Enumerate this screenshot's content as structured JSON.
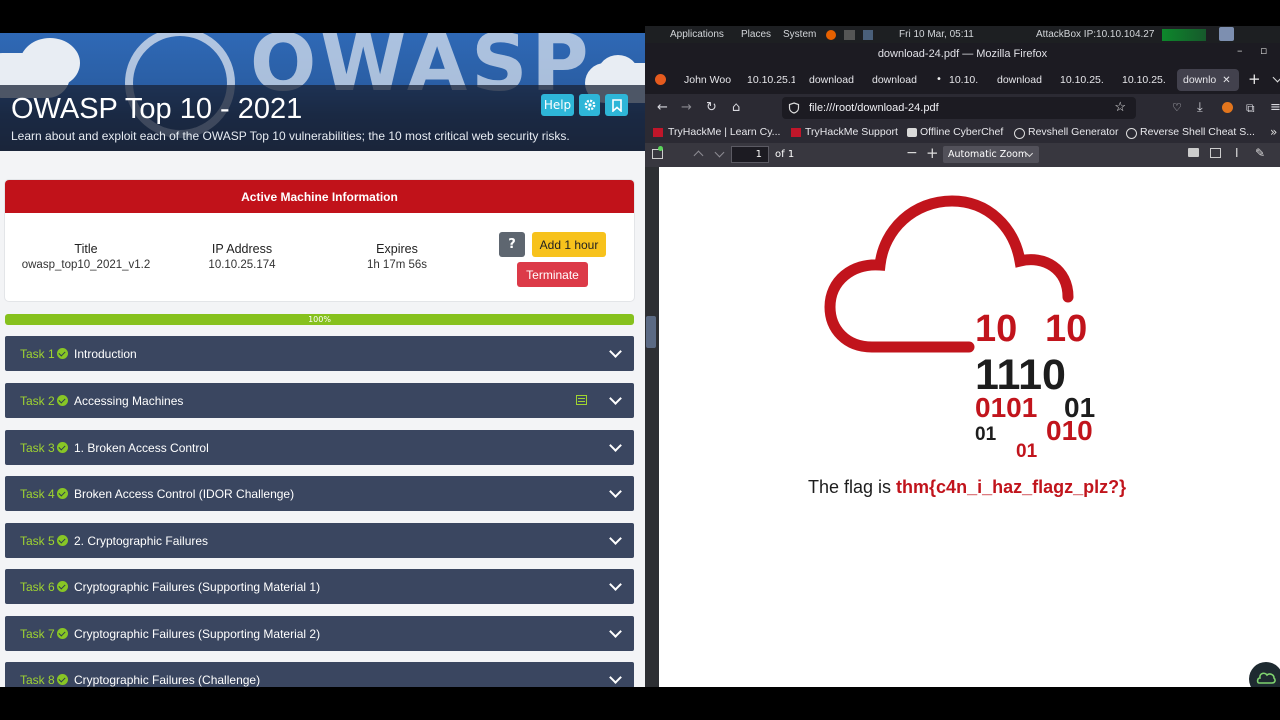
{
  "room": {
    "title": "OWASP Top 10 - 2021",
    "subtitle": "Learn about and exploit each of the OWASP Top 10 vulnerabilities; the 10 most critical web security risks.",
    "logo_text": "OWASP",
    "help_label": "Help",
    "gear_icon": "gear-icon",
    "bookmark_icon": "bookmark-icon"
  },
  "machine": {
    "header": "Active Machine Information",
    "title_label": "Title",
    "title_value": "owasp_top10_2021_v1.2",
    "ip_label": "IP Address",
    "ip_value": "10.10.25.174",
    "expires_label": "Expires",
    "expires_value": "1h 17m 56s",
    "help_q": "?",
    "add_hour": "Add 1 hour",
    "terminate": "Terminate",
    "colors": {
      "header": "#c1121a",
      "add": "#f7c21c",
      "terminate": "#dc3a48"
    }
  },
  "progress": {
    "label": "100%",
    "value": 1.0,
    "color": "#86c11d"
  },
  "tasks": [
    {
      "num": "Task 1",
      "name": "Introduction"
    },
    {
      "num": "Task 2",
      "name": "Accessing Machines"
    },
    {
      "num": "Task 3",
      "name": "1. Broken Access Control"
    },
    {
      "num": "Task 4",
      "name": "Broken Access Control (IDOR Challenge)"
    },
    {
      "num": "Task 5",
      "name": "2. Cryptographic Failures"
    },
    {
      "num": "Task 6",
      "name": "Cryptographic Failures (Supporting Material 1)"
    },
    {
      "num": "Task 7",
      "name": "Cryptographic Failures (Supporting Material 2)"
    },
    {
      "num": "Task 8",
      "name": "Cryptographic Failures (Challenge)"
    }
  ],
  "system": {
    "applications": "Applications",
    "places": "Places",
    "system": "System",
    "datetime": "Fri 10 Mar, 05:11",
    "attackbox": "AttackBox IP:10.10.104.27"
  },
  "browser": {
    "window_title": "download-24.pdf — Mozilla Firefox",
    "tabs": [
      "John Woo",
      "10.10.25.1",
      "download",
      "download",
      "10.10.",
      "download",
      "10.10.25.",
      "10.10.25.",
      "downlo"
    ],
    "url": "file:///root/download-24.pdf",
    "bookmarks": [
      "TryHackMe | Learn Cy...",
      "TryHackMe Support",
      "Offline CyberChef",
      "Revshell Generator",
      "Reverse Shell Cheat S..."
    ],
    "page_number": "1",
    "page_of": "of 1",
    "zoom": "Automatic Zoom"
  },
  "pdf": {
    "flag_prefix": "The flag is ",
    "flag": "thm{c4n_i_haz_flagz_plz?}",
    "binary": [
      "10",
      "10",
      "1110",
      "0101",
      "01",
      "01",
      "010",
      "01"
    ],
    "colors": {
      "red": "#c1141c",
      "dark": "#1d1d1d"
    }
  }
}
